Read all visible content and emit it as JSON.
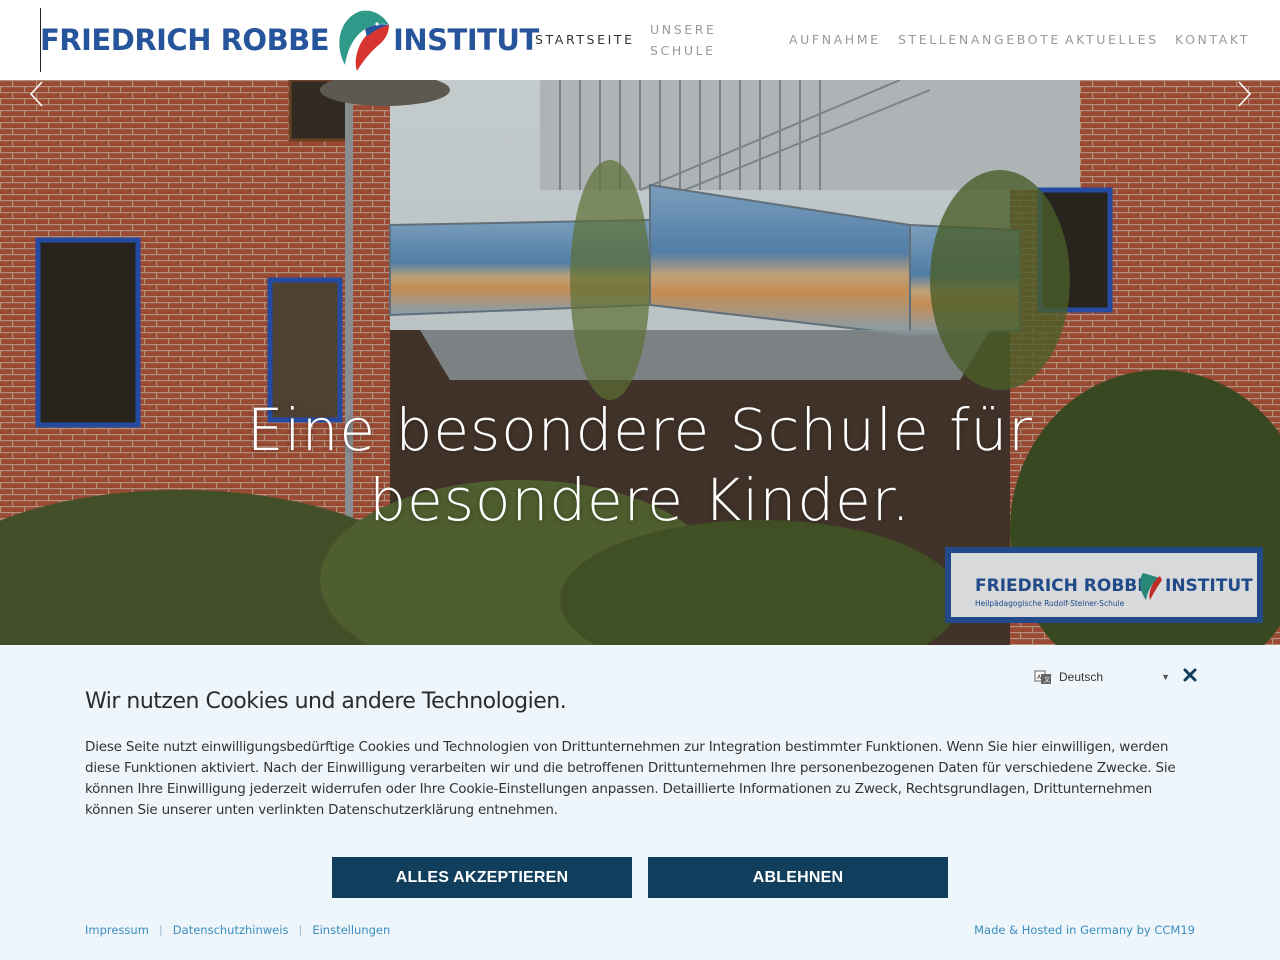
{
  "header": {
    "logo": {
      "left_text": "FRIEDRICH ROBBE",
      "right_text": "INSTITUT",
      "icon": "kingfisher-logo-icon"
    },
    "nav": [
      {
        "label": "STARTSEITE",
        "active": true
      },
      {
        "label": "UNSERE",
        "label2": "SCHULE",
        "active": false
      },
      {
        "label": "AUFNAHME",
        "active": false
      },
      {
        "label": "STELLENANGEBOTE",
        "active": false
      },
      {
        "label": "AKTUELLES",
        "active": false
      },
      {
        "label": "KONTAKT",
        "active": false
      }
    ]
  },
  "hero": {
    "title_line1": "Eine besondere Schule für",
    "title_line2": "besondere Kinder.",
    "sign_text": "FRIEDRICH ROBBE",
    "sign_text2": "INSTITUT",
    "sign_subtext": "Heilpädagogische Rudolf-Steiner-Schule",
    "prev_icon": "chevron-left-icon",
    "next_icon": "chevron-right-icon"
  },
  "cookie": {
    "title": "Wir nutzen Cookies und andere Technologien.",
    "text": "Diese Seite nutzt einwilligungsbedürftige Cookies und Technologien von Drittunternehmen zur Integration bestimmter Funktionen. Wenn Sie hier einwilligen, werden diese Funktionen aktiviert. Nach der Einwilligung verarbeiten wir und die betroffenen Drittunternehmen Ihre personenbezogenen Daten für verschiedene Zwecke. Sie können Ihre Einwilligung jederzeit widerrufen oder Ihre Cookie-Einstellungen anpassen. Detaillierte Informationen zu Zweck, Rechtsgrundlagen, Drittunternehmen können Sie unserer unten verlinkten Datenschutzerklärung entnehmen.",
    "accept_label": "ALLES AKZEPTIEREN",
    "decline_label": "ABLEHNEN",
    "language": "Deutsch",
    "links": [
      "Impressum",
      "Datenschutzhinweis",
      "Einstellungen"
    ],
    "made_by": "Made & Hosted in Germany by CCM19"
  },
  "colors": {
    "brand_blue": "#27559c",
    "button_bg": "#113e5c",
    "banner_bg": "#eef5fb",
    "link": "#3a8fc0"
  }
}
